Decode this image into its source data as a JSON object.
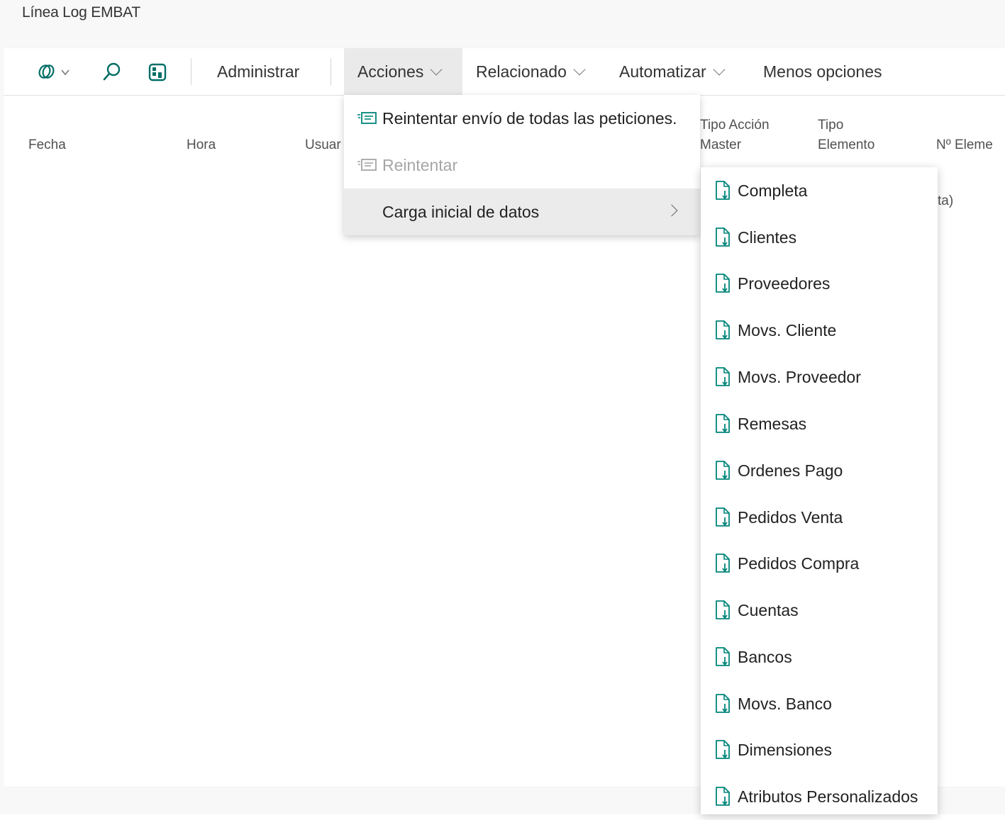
{
  "page": {
    "title": "Línea Log EMBAT"
  },
  "toolbar": {
    "icons": [
      "copilot-icon",
      "search-icon",
      "filter-pane-icon"
    ],
    "administrar": "Administrar",
    "acciones": "Acciones",
    "relacionado": "Relacionado",
    "automatizar": "Automatizar",
    "menos_opciones": "Menos opciones"
  },
  "columns": {
    "fecha": "Fecha",
    "hora": "Hora",
    "usuario": "Usuar",
    "tipo_accion_line1": "Tipo Acción",
    "tipo_accion_line2": "Master",
    "tipo_elemento_line1": "Tipo",
    "tipo_elemento_line2": "Elemento",
    "n_elemento": "Nº Eleme"
  },
  "partial_text": "ta)",
  "actions_menu": {
    "items": [
      {
        "label": "Reintentar envío de todas las peticiones.",
        "icon": "retry-send-icon",
        "disabled": false
      },
      {
        "label": "Reintentar",
        "icon": "retry-send-icon",
        "disabled": true
      },
      {
        "label": "Carga inicial de datos",
        "icon": "",
        "disabled": false,
        "submenu": true
      }
    ]
  },
  "submenu": {
    "items": [
      "Completa",
      "Clientes",
      "Proveedores",
      "Movs. Cliente",
      "Movs. Proveedor",
      "Remesas",
      "Ordenes Pago",
      "Pedidos Venta",
      "Pedidos Compra",
      "Cuentas",
      "Bancos",
      "Movs. Banco",
      "Dimensiones",
      "Atributos Personalizados"
    ],
    "icon": "report-document-icon"
  },
  "colors": {
    "accent": "#00857a",
    "disabled": "#a6a6a6",
    "highlight": "#ebebeb"
  }
}
